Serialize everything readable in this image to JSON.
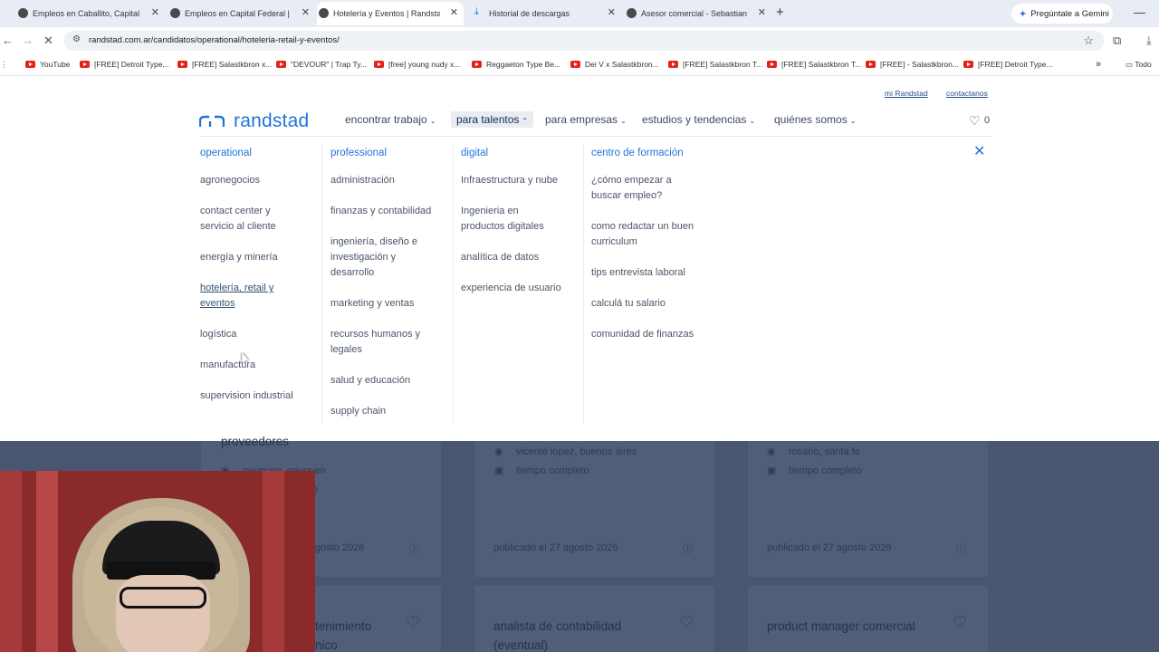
{
  "browser": {
    "tabs": [
      {
        "title": "Empleos en Caballito, Capital F",
        "active": false,
        "icon": "site-icon"
      },
      {
        "title": "Empleos en Capital Federal | Of",
        "active": false,
        "icon": "site-icon"
      },
      {
        "title": "Hotelería y Eventos | Randstad",
        "active": true,
        "icon": "site-icon"
      },
      {
        "title": "Historial de descargas",
        "active": false,
        "icon": "download-icon"
      },
      {
        "title": "Asesor comercial - Sebastian M",
        "active": false,
        "icon": "site-icon"
      }
    ],
    "gemini_label": "Pregúntale a Gemini",
    "url": "randstad.com.ar/candidatos/operational/hoteleria-retail-y-eventos/",
    "bookmarks": [
      "YouTube",
      "[FREE] Detroit Type...",
      "[FREE] Salastkbron x...",
      "\"DEVOUR\" | Trap Ty...",
      "[free] young nudy x...",
      "Reggaeton Type Be...",
      "Dei V x Salastkbron...",
      "[FREE] Salastkbron T...",
      "[FREE] Salastkbron T...",
      "[FREE] - Salastkbron...",
      "[FREE] Detroit Type..."
    ],
    "bookmarks_folder": "Todo"
  },
  "site": {
    "utility": {
      "mi_randstad": "mi Randstad",
      "contactanos": "contactanos"
    },
    "logo_text": "randstad",
    "nav": [
      {
        "label": "encontrar trabajo",
        "active": false
      },
      {
        "label": "para talentos",
        "active": true
      },
      {
        "label": "para empresas",
        "active": false
      },
      {
        "label": "estudios y tendencias",
        "active": false
      },
      {
        "label": "quiénes somos",
        "active": false
      }
    ],
    "favorites_count": "0"
  },
  "mega_menu": {
    "columns": [
      {
        "title": "operational",
        "items": [
          "agronegocios",
          "contact center y\nservicio al cliente",
          "energía y minería",
          "hotelería, retail y\neventos",
          "logística",
          "manufactura",
          "supervision industrial"
        ]
      },
      {
        "title": "professional",
        "items": [
          "administración",
          "finanzas y contabilidad",
          "ingeniería, diseño e\ninvestigación y\ndesarrollo",
          "marketing y ventas",
          "recursos humanos y\nlegales",
          "salud y educación",
          "supply chain"
        ]
      },
      {
        "title": "digital",
        "items": [
          "Infraestructura y nube",
          "Ingenieria en\nproductos digitales",
          "analítica de datos",
          "experiencia de usuario"
        ]
      },
      {
        "title": "centro de formación",
        "items": [
          "¿cómo empezar a\nbuscar empleo?",
          "como redactar un buen\ncurriculum",
          "tips entrevista laboral",
          "calculá tu salario",
          "comunidad de finanzas"
        ]
      }
    ]
  },
  "background_cards": {
    "card1": {
      "title_partial": "proveedores",
      "location": "neuquen, neuquen",
      "type_partial": "mpleto",
      "date_partial": "gosto 2026",
      "title2_partial": "tenimiento",
      "title2b_partial": "nico"
    },
    "card2": {
      "location": "vicente lopez, buenos aires",
      "type": "tiempo completo",
      "date": "publicado el 27 agosto 2026",
      "title": "analista de contabilidad",
      "title_b": "(eventual)"
    },
    "card3": {
      "location": "rosario, santa fe",
      "type": "tiempo completo",
      "date": "publicado el 27 agosto 2026",
      "title": "product manager comercial"
    }
  }
}
